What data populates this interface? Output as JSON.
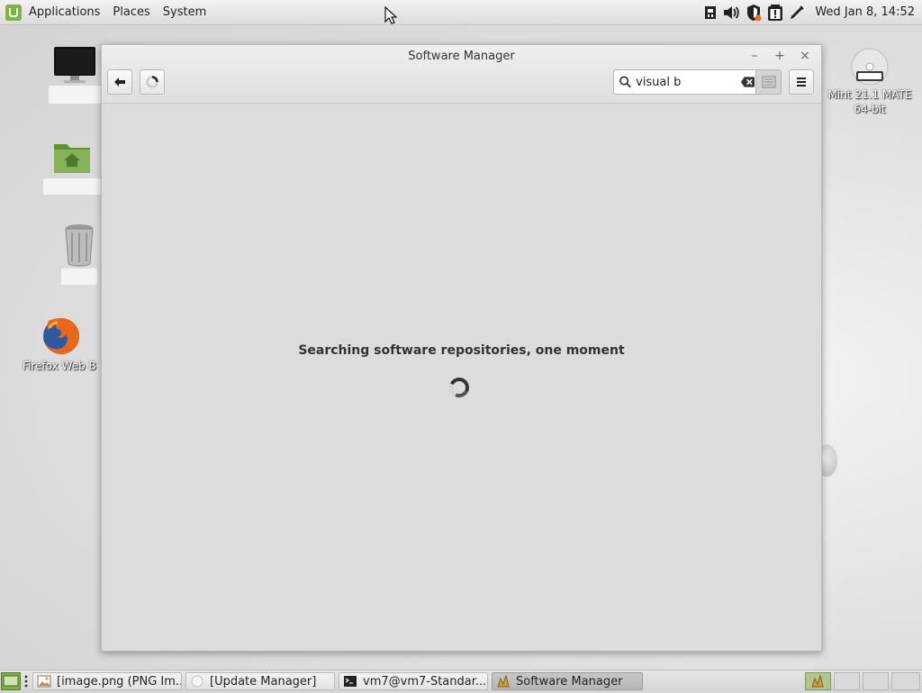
{
  "top_panel": {
    "menus": [
      "Applications",
      "Places",
      "System"
    ],
    "clock": "Wed Jan  8, 14:52",
    "tray_icons": [
      "network-wired-icon",
      "volume-icon",
      "shield-icon",
      "update-alert-icon",
      "pen-tool-icon"
    ]
  },
  "desktop": {
    "icons": [
      {
        "name": "computer-icon",
        "label": ""
      },
      {
        "name": "home-folder-icon",
        "label": ""
      },
      {
        "name": "trash-icon",
        "label": ""
      },
      {
        "name": "firefox-icon",
        "label": "Firefox Web B"
      },
      {
        "name": "dvd-icon",
        "label": "Mint 21.1 MATE 64-bit"
      }
    ]
  },
  "window": {
    "title": "Software Manager",
    "controls": {
      "minimize": "–",
      "maximize": "+",
      "close": "×"
    },
    "toolbar": {
      "back_icon": "arrow-left-icon",
      "refresh_icon": "spinner-icon",
      "search_value": "visual b",
      "search_placeholder": "",
      "menu_icon": "hamburger-icon"
    },
    "content": {
      "status_message": "Searching software repositories, one moment"
    }
  },
  "taskbar": {
    "tasks": [
      {
        "label": "[image.png (PNG Im...",
        "active": false
      },
      {
        "label": "[Update Manager]",
        "active": false
      },
      {
        "label": "vm7@vm7-Standar...",
        "active": false
      },
      {
        "label": "Software Manager",
        "active": true
      }
    ],
    "workspaces": 4
  },
  "colors": {
    "mint_green": "#7cb342",
    "accent_dark": "#333333",
    "alert_orange": "#f36c21"
  }
}
